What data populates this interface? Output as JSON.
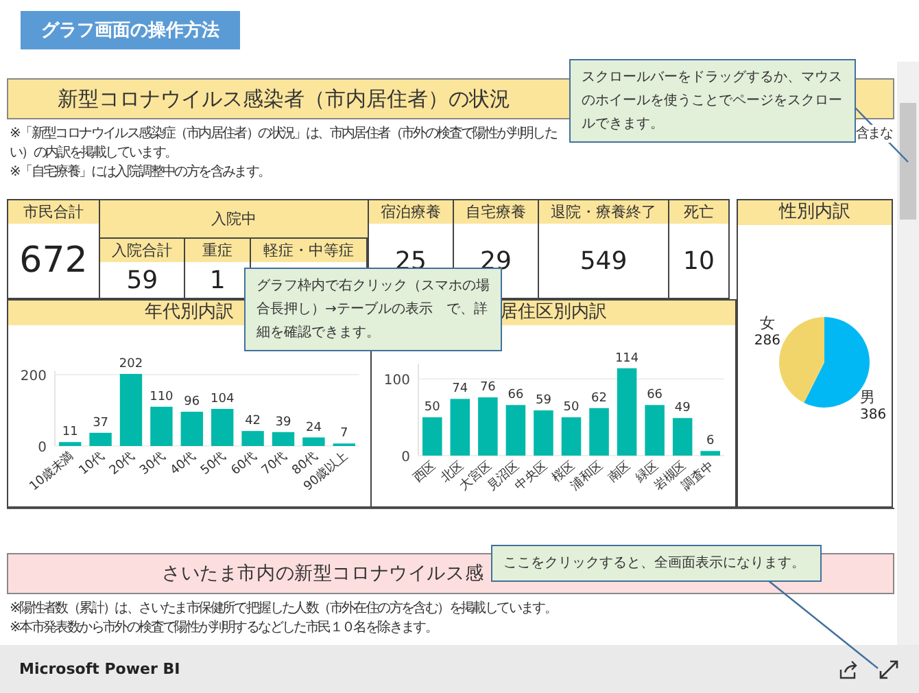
{
  "guide_button": "グラフ画面の操作方法",
  "section1": {
    "title": "新型コロナウイルス感染者（市内居住者）の状況",
    "notes": [
      {
        "left": "※「新型コロナウイルス感染症（市内居住者）の状況」は、市内居住者（市外の検査で陽性が判明した",
        "right": "含まな"
      },
      {
        "left": "い）の内訳を掲載しています。"
      },
      {
        "left": "※「自宅療養」には入院調整中の方を含みます。"
      }
    ],
    "stats": [
      {
        "kind": "total",
        "label": "市民合計",
        "value": "672"
      },
      {
        "kind": "group",
        "label": "入院中",
        "children": [
          {
            "label": "入院合計",
            "value": "59"
          },
          {
            "label": "重症",
            "value": "1"
          },
          {
            "label": "軽症・中等症"
          }
        ]
      },
      {
        "kind": "single",
        "label": "宿泊療養",
        "value": "25"
      },
      {
        "kind": "single",
        "label": "自宅療養",
        "value": "29"
      },
      {
        "kind": "single",
        "label": "退院・療養終了",
        "value": "549"
      },
      {
        "kind": "single",
        "label": "死亡",
        "value": "10"
      }
    ],
    "age_chart": {
      "title": "年代別内訳",
      "chart_data": {
        "type": "bar",
        "categories": [
          "10歳未満",
          "10代",
          "20代",
          "30代",
          "40代",
          "50代",
          "60代",
          "70代",
          "80代",
          "90歳以上"
        ],
        "values": [
          11,
          37,
          202,
          110,
          96,
          104,
          42,
          39,
          24,
          7
        ],
        "ylim": [
          0,
          210
        ],
        "yticks": [
          0,
          200
        ],
        "data_labels": true
      }
    },
    "ward_chart": {
      "title": "居住区別内訳",
      "chart_data": {
        "type": "bar",
        "categories": [
          "西区",
          "北区",
          "大宮区",
          "見沼区",
          "中央区",
          "桜区",
          "浦和区",
          "南区",
          "緑区",
          "岩槻区",
          "調査中"
        ],
        "values": [
          50,
          74,
          76,
          66,
          59,
          50,
          62,
          114,
          66,
          49,
          6
        ],
        "ylim": [
          0,
          120
        ],
        "yticks": [
          0,
          100
        ],
        "data_labels": true
      }
    },
    "gender_chart": {
      "title": "性別内訳",
      "chart_data": {
        "type": "pie",
        "categories": [
          "女",
          "男"
        ],
        "values": [
          286,
          386
        ],
        "colors": [
          "#f2d56a",
          "#01b8f5"
        ],
        "data_labels": true
      }
    }
  },
  "section2": {
    "title": "さいたま市内の新型コロナウイルス感",
    "notes": [
      "※陽性者数（累計）は、さいたま市保健所で把握した人数（市外在住の方を含む）を掲載しています。",
      "※本市発表数から市外の検査で陽性が判明するなどした市民１０名を除きます。"
    ]
  },
  "callouts": [
    {
      "text": "スクロールバーをドラッグするか、マウスのホイールを使うことでページをスクロールできます。"
    },
    {
      "text": "グラフ枠内で右クリック（スマホの場合長押し）→テーブルの表示　で、詳細を確認できます。"
    },
    {
      "text": "ここをクリックすると、全画面表示になります。"
    }
  ],
  "footer": {
    "brand": "Microsoft Power BI"
  }
}
